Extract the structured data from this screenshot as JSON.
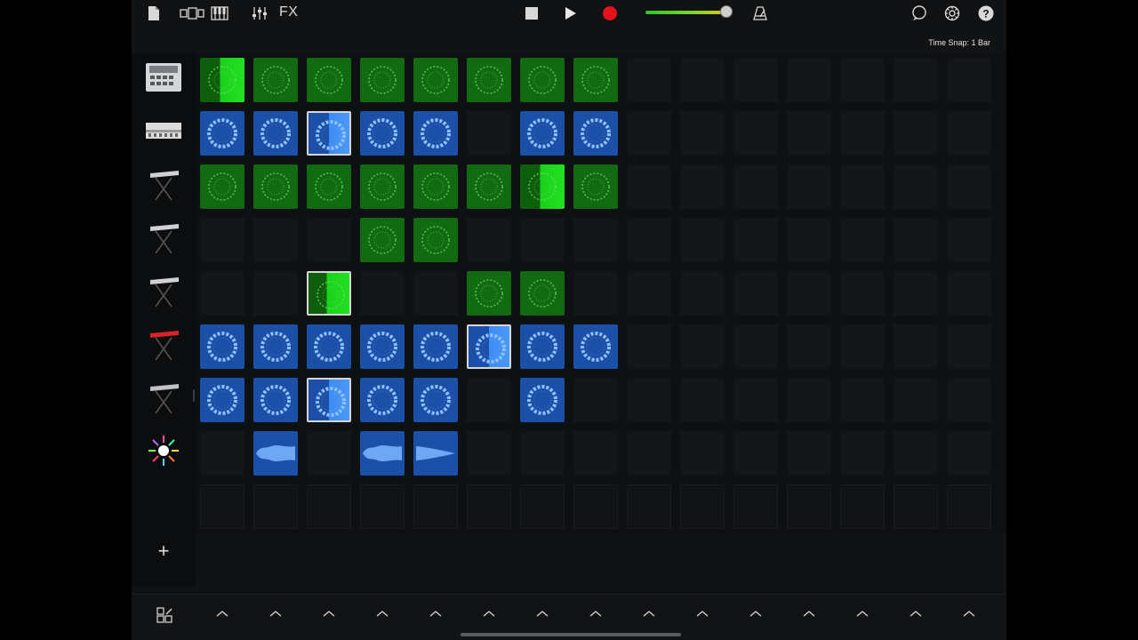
{
  "toolbar": {
    "icons": [
      "document-icon",
      "tracks-view-icon",
      "keyboard-icon",
      "mixer-icon",
      "stop-icon",
      "play-icon",
      "record-icon",
      "metronome-icon",
      "loop-browser-icon",
      "settings-icon",
      "help-icon"
    ],
    "fx_label": "FX",
    "master_volume": 0.95,
    "colors": {
      "record": "#e3131b",
      "volume_start": "#2ec52e",
      "volume_end": "#e0c51f"
    }
  },
  "time_snap": "Time Snap: 1 Bar",
  "tracks": [
    {
      "instrument": "beat-sequencer-icon"
    },
    {
      "instrument": "drum-machine-icon"
    },
    {
      "instrument": "synth-keyboard-icon"
    },
    {
      "instrument": "synth-keyboard-icon"
    },
    {
      "instrument": "synth-keyboard-icon"
    },
    {
      "instrument": "red-keyboard-icon"
    },
    {
      "instrument": "synth-keyboard-icon"
    },
    {
      "instrument": "audio-recorder-icon"
    }
  ],
  "add_track_label": "+",
  "cells": [
    [
      "playing-green",
      "green",
      "green",
      "green",
      "green",
      "green",
      "green",
      "green"
    ],
    [
      "blue",
      "blue",
      "playing-blue-selected",
      "blue",
      "blue",
      "empty",
      "blue",
      "blue"
    ],
    [
      "green",
      "green",
      "green",
      "green",
      "green",
      "green",
      "playing-green",
      "green"
    ],
    [
      "empty",
      "empty",
      "empty",
      "green",
      "green",
      "empty",
      "empty",
      "empty"
    ],
    [
      "empty",
      "empty",
      "playing-green-selected",
      "empty",
      "empty",
      "green",
      "green",
      "empty"
    ],
    [
      "blue",
      "blue",
      "blue",
      "blue",
      "blue",
      "playing-blue-selected",
      "blue",
      "blue"
    ],
    [
      "blue",
      "blue",
      "playing-blue-selected",
      "blue",
      "blue",
      "empty",
      "blue",
      "empty"
    ],
    [
      "empty",
      "wave",
      "empty",
      "wave",
      "wave-fade",
      "empty",
      "empty",
      "empty"
    ]
  ],
  "grid_columns": 15,
  "colors": {
    "green": "#126a12",
    "blue": "#1b4fa8",
    "playing_green": "#22e022",
    "playing_blue": "#4b98f8"
  }
}
